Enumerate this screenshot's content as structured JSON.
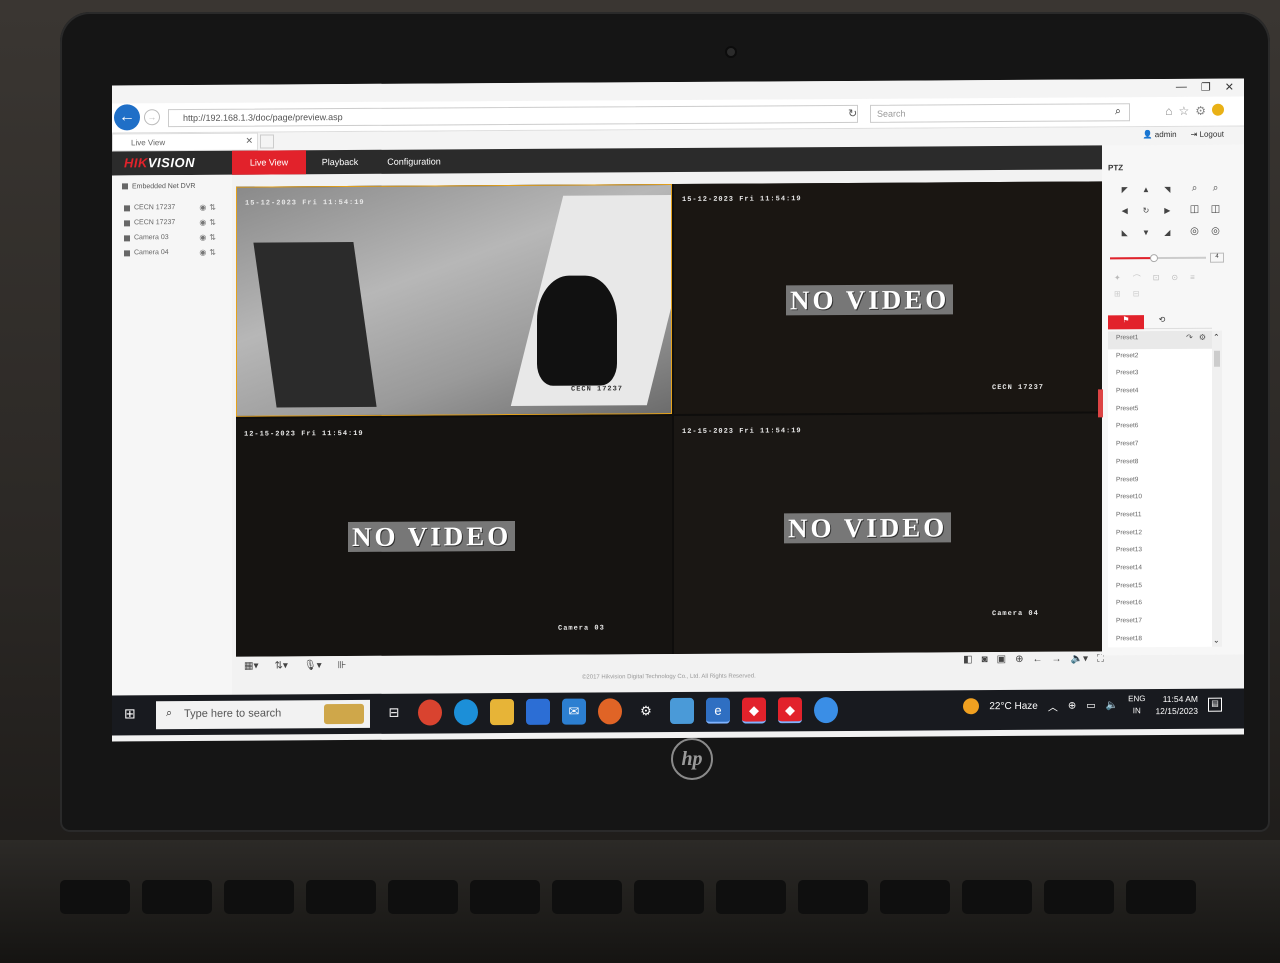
{
  "browser": {
    "url": "http://192.168.1.3/doc/page/preview.asp",
    "search_placeholder": "Search",
    "tab_title": "Live View"
  },
  "user": {
    "name": "admin",
    "logout": "Logout"
  },
  "app": {
    "brand_red": "HIK",
    "brand_white": "VISION",
    "nav": [
      {
        "label": "Live View",
        "active": true
      },
      {
        "label": "Playback"
      },
      {
        "label": "Configuration"
      }
    ],
    "accent_color": "#e2222b"
  },
  "tree": {
    "root": "Embedded Net DVR",
    "cameras": [
      "CECN 17237",
      "CECN 17237",
      "Camera 03",
      "Camera 04"
    ]
  },
  "video": {
    "cells": [
      {
        "osd": "15-12-2023 Fri 11:54:19",
        "label": "CECN 17237",
        "no_video": false
      },
      {
        "osd": "15-12-2023 Fri 11:54:19",
        "label": "CECN 17237",
        "no_video": true,
        "no_video_text": "NO VIDEO"
      },
      {
        "osd": "12-15-2023 Fri 11:54:19",
        "label": "Camera 03",
        "no_video": true,
        "no_video_text": "NO VIDEO"
      },
      {
        "osd": "12-15-2023 Fri 11:54:19",
        "label": "Camera 04",
        "no_video": true,
        "no_video_text": "NO VIDEO"
      }
    ]
  },
  "footer": {
    "copyright": "©2017 Hikvision Digital Technology Co., Ltd. All Rights Reserved."
  },
  "ptz": {
    "title": "PTZ",
    "speed": "4",
    "speed_fraction": 0.44,
    "presets": [
      "Preset1",
      "Preset2",
      "Preset3",
      "Preset4",
      "Preset5",
      "Preset6",
      "Preset7",
      "Preset8",
      "Preset9",
      "Preset10",
      "Preset11",
      "Preset12",
      "Preset13",
      "Preset14",
      "Preset15",
      "Preset16",
      "Preset17",
      "Preset18"
    ]
  },
  "taskbar": {
    "search_placeholder": "Type here to search",
    "weather": "22°C  Haze",
    "lang_top": "ENG",
    "lang_bottom": "IN",
    "time": "11:54 AM",
    "date": "12/15/2023"
  }
}
